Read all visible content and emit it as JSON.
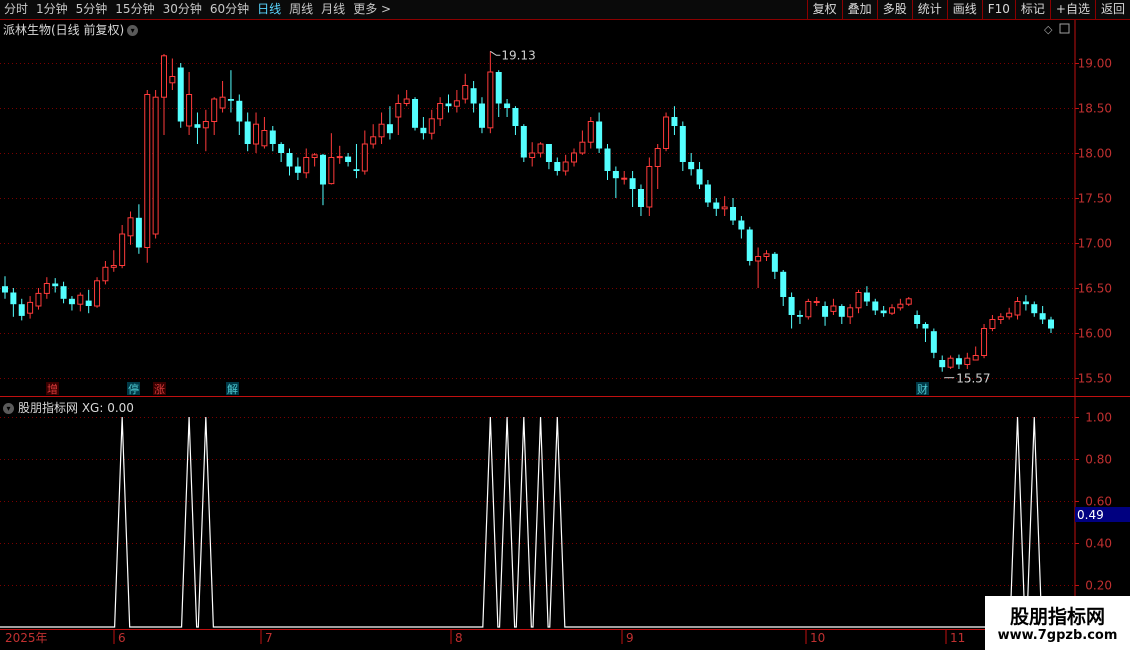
{
  "toolbar": {
    "periods": [
      "分时",
      "1分钟",
      "5分钟",
      "15分钟",
      "30分钟",
      "60分钟",
      "日线",
      "周线",
      "月线",
      "更多 >"
    ],
    "active_period": "日线",
    "buttons": [
      "复权",
      "叠加",
      "多股",
      "统计",
      "画线",
      "F10",
      "标记",
      "+自选",
      "返回"
    ]
  },
  "main_chart": {
    "title": "派林生物(日线 前复权)",
    "y_ticks": [
      "19.00",
      "18.50",
      "18.00",
      "17.50",
      "17.00",
      "16.50",
      "16.00",
      "15.50"
    ],
    "max_label": "19.13",
    "min_label": "15.57",
    "event_markers": [
      {
        "label": "增",
        "color": "#d83a3a"
      },
      {
        "label": "停",
        "color": "#4ec8d0"
      },
      {
        "label": "涨",
        "color": "#d83a3a"
      },
      {
        "label": "解",
        "color": "#4ec8d0"
      },
      {
        "label": "财",
        "color": "#4ec8d0"
      }
    ]
  },
  "indicator": {
    "title": "股朋指标网 XG: 0.00",
    "y_ticks": [
      "1.00",
      "0.80",
      "0.60",
      "0.40",
      "0.20"
    ],
    "current_value": "0.49"
  },
  "x_axis": {
    "labels": [
      "2025年",
      "6",
      "7",
      "8",
      "9",
      "10",
      "11"
    ]
  },
  "watermark": {
    "main": "股朋指标网",
    "url": "www.7gpzb.com"
  },
  "colors": {
    "up": "#ff3b3b",
    "down": "#54ffff",
    "grid": "#7a0000",
    "axis": "#c01010",
    "signal": "#ffffff",
    "highlight_box": "#000080"
  },
  "chart_data": {
    "type": "candlestick",
    "y_range": [
      15.3,
      19.3
    ],
    "candles": [
      [
        16.52,
        16.45,
        16.63,
        16.38
      ],
      [
        16.45,
        16.32,
        16.5,
        16.18
      ],
      [
        16.32,
        16.19,
        16.38,
        16.14
      ],
      [
        16.22,
        16.34,
        16.41,
        16.16
      ],
      [
        16.3,
        16.44,
        16.5,
        16.26
      ],
      [
        16.44,
        16.55,
        16.62,
        16.38
      ],
      [
        16.55,
        16.52,
        16.61,
        16.45
      ],
      [
        16.52,
        16.38,
        16.57,
        16.33
      ],
      [
        16.38,
        16.32,
        16.41,
        16.25
      ],
      [
        16.32,
        16.42,
        16.45,
        16.24
      ],
      [
        16.36,
        16.3,
        16.48,
        16.22
      ],
      [
        16.3,
        16.58,
        16.62,
        16.28
      ],
      [
        16.58,
        16.73,
        16.8,
        16.54
      ],
      [
        16.73,
        16.75,
        16.92,
        16.68
      ],
      [
        16.75,
        17.1,
        17.2,
        16.72
      ],
      [
        17.08,
        17.28,
        17.35,
        16.98
      ],
      [
        17.28,
        16.95,
        17.43,
        16.88
      ],
      [
        16.95,
        18.65,
        18.7,
        16.78
      ],
      [
        17.1,
        18.62,
        18.7,
        17.05
      ],
      [
        18.62,
        19.08,
        19.1,
        18.2
      ],
      [
        18.78,
        18.85,
        19.05,
        18.7
      ],
      [
        18.95,
        18.35,
        19.0,
        18.28
      ],
      [
        18.3,
        18.65,
        18.9,
        18.2
      ],
      [
        18.32,
        18.28,
        18.45,
        18.1
      ],
      [
        18.28,
        18.35,
        18.48,
        18.02
      ],
      [
        18.35,
        18.6,
        18.62,
        18.2
      ],
      [
        18.5,
        18.62,
        18.8,
        18.45
      ],
      [
        18.6,
        18.58,
        18.92,
        18.45
      ],
      [
        18.58,
        18.35,
        18.65,
        18.2
      ],
      [
        18.35,
        18.1,
        18.45,
        18.02
      ],
      [
        18.1,
        18.32,
        18.45,
        18.0
      ],
      [
        18.08,
        18.25,
        18.4,
        18.05
      ],
      [
        18.25,
        18.1,
        18.3,
        18.02
      ],
      [
        18.1,
        18.0,
        18.12,
        17.9
      ],
      [
        18.0,
        17.85,
        18.05,
        17.75
      ],
      [
        17.85,
        17.78,
        17.95,
        17.7
      ],
      [
        17.78,
        17.95,
        18.05,
        17.72
      ],
      [
        17.95,
        17.98,
        18.0,
        17.85
      ],
      [
        17.98,
        17.65,
        17.99,
        17.42
      ],
      [
        17.66,
        17.95,
        18.22,
        17.65
      ],
      [
        17.95,
        17.96,
        18.08,
        17.88
      ],
      [
        17.96,
        17.9,
        18.0,
        17.85
      ],
      [
        17.82,
        17.8,
        18.1,
        17.72
      ],
      [
        17.8,
        18.1,
        18.25,
        17.76
      ],
      [
        18.1,
        18.18,
        18.32,
        18.05
      ],
      [
        18.18,
        18.32,
        18.45,
        18.1
      ],
      [
        18.32,
        18.22,
        18.52,
        18.15
      ],
      [
        18.4,
        18.55,
        18.65,
        18.2
      ],
      [
        18.55,
        18.6,
        18.7,
        18.52
      ],
      [
        18.6,
        18.28,
        18.62,
        18.25
      ],
      [
        18.28,
        18.22,
        18.4,
        18.15
      ],
      [
        18.22,
        18.38,
        18.48,
        18.15
      ],
      [
        18.38,
        18.55,
        18.62,
        18.3
      ],
      [
        18.55,
        18.52,
        18.65,
        18.45
      ],
      [
        18.52,
        18.58,
        18.7,
        18.45
      ],
      [
        18.6,
        18.75,
        18.88,
        18.55
      ],
      [
        18.72,
        18.55,
        18.8,
        18.45
      ],
      [
        18.55,
        18.28,
        18.62,
        18.22
      ],
      [
        18.28,
        18.9,
        19.13,
        18.22
      ],
      [
        18.9,
        18.55,
        18.92,
        18.4
      ],
      [
        18.55,
        18.5,
        18.6,
        18.4
      ],
      [
        18.5,
        18.3,
        18.52,
        18.2
      ],
      [
        18.3,
        17.95,
        18.32,
        17.9
      ],
      [
        17.95,
        18.0,
        18.12,
        17.85
      ],
      [
        18.0,
        18.1,
        18.12,
        17.95
      ],
      [
        18.1,
        17.9,
        18.1,
        17.82
      ],
      [
        17.9,
        17.8,
        17.95,
        17.75
      ],
      [
        17.8,
        17.9,
        17.98,
        17.75
      ],
      [
        17.9,
        18.0,
        18.05,
        17.85
      ],
      [
        18.0,
        18.12,
        18.25,
        17.98
      ],
      [
        18.12,
        18.35,
        18.4,
        18.05
      ],
      [
        18.35,
        18.05,
        18.45,
        18.0
      ],
      [
        18.05,
        17.8,
        18.1,
        17.7
      ],
      [
        17.8,
        17.72,
        17.85,
        17.5
      ],
      [
        17.72,
        17.72,
        17.8,
        17.65
      ],
      [
        17.72,
        17.6,
        17.8,
        17.4
      ],
      [
        17.6,
        17.4,
        17.65,
        17.3
      ],
      [
        17.4,
        17.85,
        17.95,
        17.3
      ],
      [
        17.85,
        18.05,
        18.1,
        17.6
      ],
      [
        18.05,
        18.4,
        18.45,
        18.02
      ],
      [
        18.4,
        18.3,
        18.52,
        18.2
      ],
      [
        18.3,
        17.9,
        18.35,
        17.8
      ],
      [
        17.9,
        17.82,
        18.0,
        17.75
      ],
      [
        17.82,
        17.65,
        17.9,
        17.6
      ],
      [
        17.65,
        17.45,
        17.7,
        17.4
      ],
      [
        17.45,
        17.38,
        17.5,
        17.3
      ],
      [
        17.38,
        17.4,
        17.52,
        17.3
      ],
      [
        17.4,
        17.25,
        17.5,
        17.2
      ],
      [
        17.25,
        17.15,
        17.3,
        17.05
      ],
      [
        17.15,
        16.8,
        17.18,
        16.75
      ],
      [
        16.8,
        16.85,
        16.95,
        16.5
      ],
      [
        16.85,
        16.88,
        16.92,
        16.8
      ],
      [
        16.88,
        16.68,
        16.9,
        16.6
      ],
      [
        16.68,
        16.4,
        16.7,
        16.3
      ],
      [
        16.4,
        16.2,
        16.45,
        16.05
      ],
      [
        16.2,
        16.18,
        16.25,
        16.1
      ],
      [
        16.18,
        16.35,
        16.38,
        16.15
      ],
      [
        16.35,
        16.35,
        16.4,
        16.3
      ],
      [
        16.3,
        16.18,
        16.35,
        16.08
      ],
      [
        16.24,
        16.3,
        16.38,
        16.2
      ],
      [
        16.3,
        16.18,
        16.32,
        16.1
      ],
      [
        16.18,
        16.28,
        16.32,
        16.1
      ],
      [
        16.28,
        16.45,
        16.48,
        16.22
      ],
      [
        16.45,
        16.35,
        16.52,
        16.3
      ],
      [
        16.35,
        16.25,
        16.38,
        16.2
      ],
      [
        16.25,
        16.22,
        16.3,
        16.18
      ],
      [
        16.22,
        16.28,
        16.32,
        16.2
      ],
      [
        16.28,
        16.32,
        16.38,
        16.25
      ],
      [
        16.32,
        16.38,
        16.4,
        16.3
      ],
      [
        16.2,
        16.1,
        16.25,
        16.05
      ],
      [
        16.1,
        16.05,
        16.12,
        15.9
      ],
      [
        16.02,
        15.78,
        16.05,
        15.72
      ],
      [
        15.7,
        15.62,
        15.75,
        15.57
      ],
      [
        15.62,
        15.72,
        15.75,
        15.6
      ],
      [
        15.72,
        15.65,
        15.76,
        15.6
      ],
      [
        15.65,
        15.72,
        15.78,
        15.6
      ],
      [
        15.7,
        15.75,
        15.85,
        15.7
      ],
      [
        15.75,
        16.05,
        16.1,
        15.72
      ],
      [
        16.05,
        16.15,
        16.2,
        16.02
      ],
      [
        16.15,
        16.18,
        16.22,
        16.1
      ],
      [
        16.18,
        16.22,
        16.28,
        16.15
      ],
      [
        16.2,
        16.35,
        16.4,
        16.15
      ],
      [
        16.35,
        16.32,
        16.42,
        16.25
      ],
      [
        16.32,
        16.22,
        16.35,
        16.18
      ],
      [
        16.22,
        16.15,
        16.3,
        16.1
      ],
      [
        16.15,
        16.05,
        16.18,
        16.0
      ]
    ],
    "signals": [
      0,
      0,
      0,
      0,
      0,
      0,
      0,
      0,
      0,
      0,
      0,
      0,
      0,
      0,
      1,
      0,
      0,
      0,
      0,
      0,
      0,
      0,
      1,
      0,
      1,
      0,
      0,
      0,
      0,
      0,
      0,
      0,
      0,
      0,
      0,
      0,
      0,
      0,
      0,
      0,
      0,
      0,
      0,
      0,
      0,
      0,
      0,
      0,
      0,
      0,
      0,
      0,
      0,
      0,
      0,
      0,
      0,
      0,
      1,
      0,
      1,
      0,
      1,
      0,
      1,
      0,
      1,
      0,
      0,
      0,
      0,
      0,
      0,
      0,
      0,
      0,
      0,
      0,
      0,
      0,
      0,
      0,
      0,
      0,
      0,
      0,
      0,
      0,
      0,
      0,
      0,
      0,
      0,
      0,
      0,
      0,
      0,
      0,
      0,
      0,
      0,
      0,
      0,
      0,
      0,
      0,
      0,
      0,
      0,
      0,
      0,
      0,
      0,
      0,
      0,
      0,
      0,
      0,
      0,
      0,
      0,
      1,
      0,
      1,
      0,
      0,
      0
    ]
  }
}
